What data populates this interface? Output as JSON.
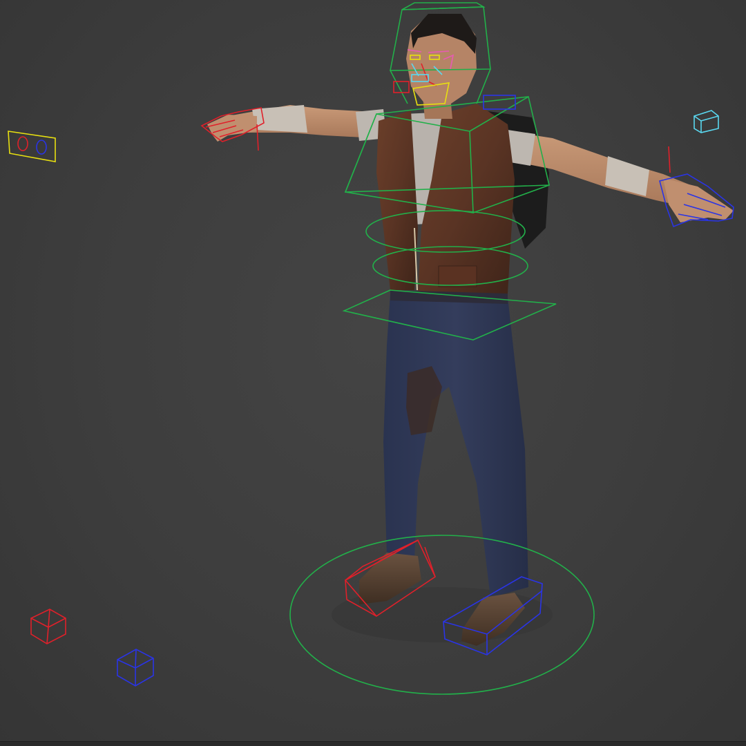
{
  "viewport": {
    "background": "#3c3c3c",
    "content": "3d-character-rig"
  },
  "colors": {
    "spine_controls": "#22b04a",
    "left_side_controls": "#e0202a",
    "right_side_controls": "#2a34e6",
    "eye_controls": "#e8e010",
    "face_cyan": "#5ad8f0",
    "face_magenta": "#e85ab4",
    "helper_cyan": "#5ad8f0"
  },
  "icons": {
    "eyes_target": "eyes-target-control-icon",
    "red_helper": "red-box-helper-icon",
    "blue_helper": "blue-box-helper-icon",
    "cyan_helper": "cyan-box-helper-icon"
  }
}
